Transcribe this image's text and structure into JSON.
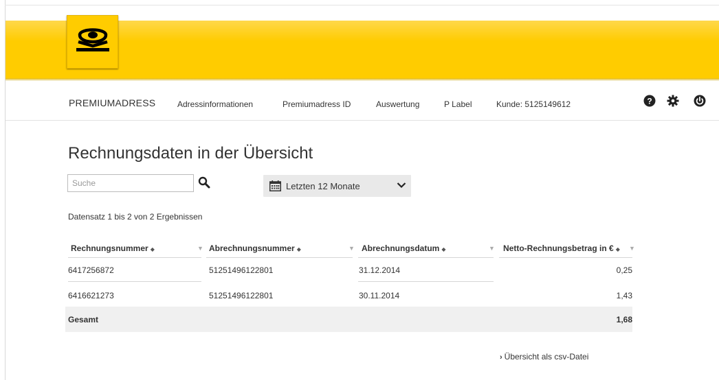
{
  "header": {
    "logo_name": "Deutsche Post posthorn logo",
    "brand_color": "#ffcc00"
  },
  "nav": {
    "brand": "PREMIUMADRESS",
    "links": [
      {
        "label": "Adressinformationen"
      },
      {
        "label": "Premiumadress ID"
      },
      {
        "label": "Auswertung"
      },
      {
        "label": "P Label"
      }
    ],
    "customer": "Kunde: 5125149612",
    "icons": [
      "help-icon",
      "settings-gear-icon",
      "power-logout-icon"
    ]
  },
  "main": {
    "title": "Rechnungsdaten in der Übersicht",
    "search": {
      "placeholder": "Suche",
      "value": ""
    },
    "period_select": {
      "selected": "Letzten 12 Monate"
    },
    "result_info": "Datensatz 1 bis 2 von 2 Ergebnissen"
  },
  "table": {
    "sort_glyph": "◆",
    "filter_glyph": "▼",
    "columns": [
      {
        "label": "Rechnungsnummer"
      },
      {
        "label": "Abrechnungsnummer"
      },
      {
        "label": "Abrechnungsdatum"
      },
      {
        "label": "Netto-Rechnungsbetrag in €"
      }
    ],
    "rows": [
      {
        "rechnungsnummer": "6417256872",
        "abrechnungsnummer": "51251496122801",
        "datum": "31.12.2014",
        "betrag": "0,25"
      },
      {
        "rechnungsnummer": "6416621273",
        "abrechnungsnummer": "51251496122801",
        "datum": "30.11.2014",
        "betrag": "1,43"
      }
    ],
    "total": {
      "label": "Gesamt",
      "value": "1,68"
    }
  },
  "footer": {
    "csv_arrow": "›",
    "csv_link": "Übersicht als csv-Datei"
  }
}
